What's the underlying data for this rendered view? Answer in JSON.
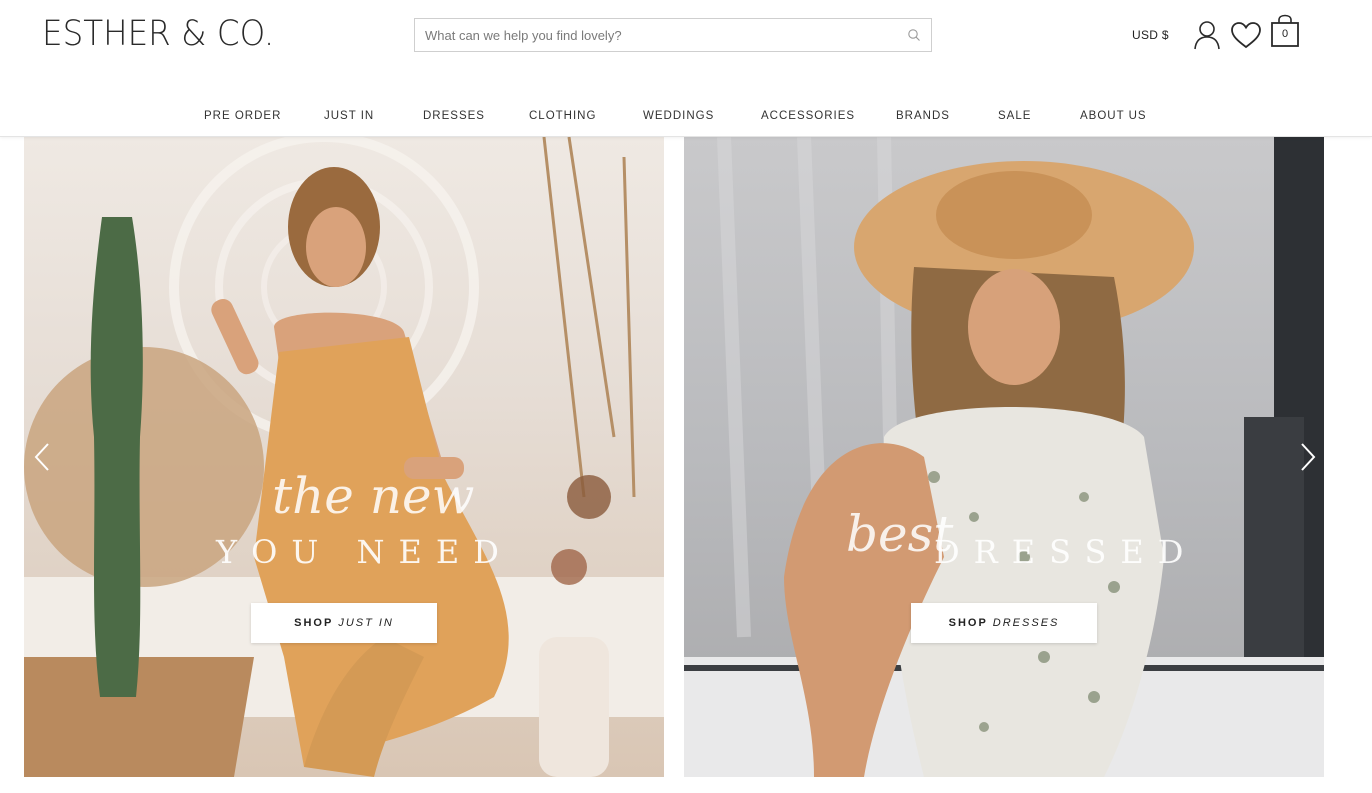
{
  "header": {
    "logo": "ESTHER & CO.",
    "search": {
      "placeholder": "What can we help you find lovely?"
    },
    "currency": "USD $",
    "cart_count": "0",
    "icons": [
      "search-icon",
      "account-icon",
      "wishlist-heart-icon",
      "shopping-bag-icon"
    ]
  },
  "nav": {
    "items": [
      "PRE ORDER",
      "JUST IN",
      "DRESSES",
      "CLOTHING",
      "WEDDINGS",
      "ACCESSORIES",
      "BRANDS",
      "SALE",
      "ABOUT US"
    ]
  },
  "banners": [
    {
      "script": "the new",
      "caps": "YOU NEED",
      "button_strong": "SHOP",
      "button_em": "JUST IN"
    },
    {
      "script": "best",
      "caps": "DRESSED",
      "button_strong": "SHOP",
      "button_em": "DRESSES"
    }
  ],
  "colors": {
    "text": "#222222",
    "border": "#cfcfcf",
    "white": "#ffffff"
  }
}
